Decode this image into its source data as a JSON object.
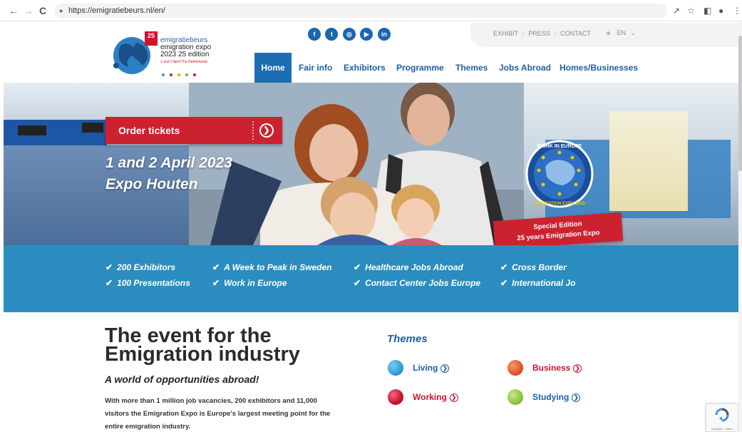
{
  "browser": {
    "url": "https://emigratiebeurs.nl/en/",
    "back_icon": "←",
    "forward_icon": "→",
    "reload_icon": "C",
    "lock_icon": "🔒"
  },
  "logo": {
    "badge": "25",
    "line1": "emigratiebeurs",
    "line2": "emigration expo",
    "line3": "2023  25 edition",
    "line4": "1 and 2 April The Netherlands",
    "dot_colors": [
      "#2d9fd8",
      "#d0142c",
      "#f2a800",
      "#6db33f",
      "#d0142c"
    ]
  },
  "social": [
    "f",
    "t",
    "◎",
    "▶",
    "in"
  ],
  "toplinks": [
    "EXHIBIT",
    "PRESS",
    "CONTACT"
  ],
  "lang": "EN",
  "nav": [
    "Home",
    "Fair info",
    "Exhibitors",
    "Programme",
    "Themes",
    "Jobs Abroad",
    "Homes/Businesses"
  ],
  "hero": {
    "order_label": "Order tickets",
    "date_line1": "1 and 2 April 2023",
    "date_line2": "Expo Houten",
    "euro_badge_top": "WORK IN EUROPE",
    "euro_badge_bottom": "EMIGRATION EXPO 2023",
    "special_line1": "Special Edition",
    "special_line2": "25 years Emigration Expo"
  },
  "band": [
    "200 Exhibitors",
    "A Week to Peak in Sweden",
    "Healthcare Jobs Abroad",
    "Cross Border",
    "100 Presentations",
    "Work in Europe",
    "Contact Center Jobs Europe",
    "International Jo"
  ],
  "content": {
    "title_line1": "The event for the",
    "title_line2": "Emigration industry",
    "subtitle": "A world of opportunities abroad!",
    "body": "With more than 1 million job vacancies, 200 exhibitors and 11,000 visitors the Emigration Expo is Europe's largest meeting point for the entire emigration industry."
  },
  "themes": {
    "title": "Themes",
    "items": [
      {
        "label": "Living",
        "color": "#1d5fa8",
        "ball": "#2d9fd8"
      },
      {
        "label": "Business",
        "color": "#d0142c",
        "ball": "#e0542c"
      },
      {
        "label": "Working",
        "color": "#d0142c",
        "ball": "#c8102e"
      },
      {
        "label": "Studying",
        "color": "#1d5fa8",
        "ball": "#8cc63f"
      }
    ]
  },
  "recaptcha_text": "Integritet - Villkor"
}
